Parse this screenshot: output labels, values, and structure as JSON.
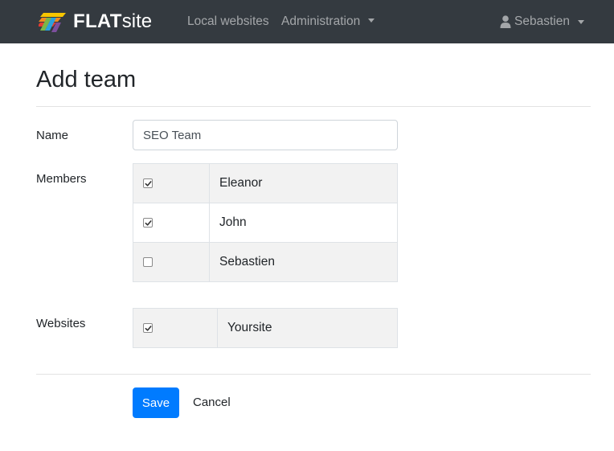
{
  "navbar": {
    "brand": {
      "bold": "FLAT",
      "light": "site",
      "logo_icon": "flatsite-logo-icon"
    },
    "links": [
      {
        "label": "Local websites"
      },
      {
        "label": "Administration",
        "has_dropdown": true
      }
    ],
    "user": {
      "name": "Sebastien",
      "icon": "user-icon",
      "has_dropdown": true
    }
  },
  "page": {
    "title": "Add team"
  },
  "form": {
    "name": {
      "label": "Name",
      "value": "SEO Team",
      "placeholder": ""
    },
    "members": {
      "label": "Members",
      "rows": [
        {
          "name": "Eleanor",
          "checked": true
        },
        {
          "name": "John",
          "checked": true
        },
        {
          "name": "Sebastien",
          "checked": false
        }
      ]
    },
    "websites": {
      "label": "Websites",
      "rows": [
        {
          "name": "Yoursite",
          "checked": true
        }
      ]
    },
    "actions": {
      "save_label": "Save",
      "cancel_label": "Cancel"
    }
  },
  "colors": {
    "navbar_bg": "#343a40",
    "primary": "#007bff",
    "row_striped": "#f2f2f2",
    "logo_colors": [
      "#f7c600",
      "#f28c1e",
      "#e23c32",
      "#7ab648",
      "#2aa3df",
      "#7d4f9e"
    ]
  }
}
